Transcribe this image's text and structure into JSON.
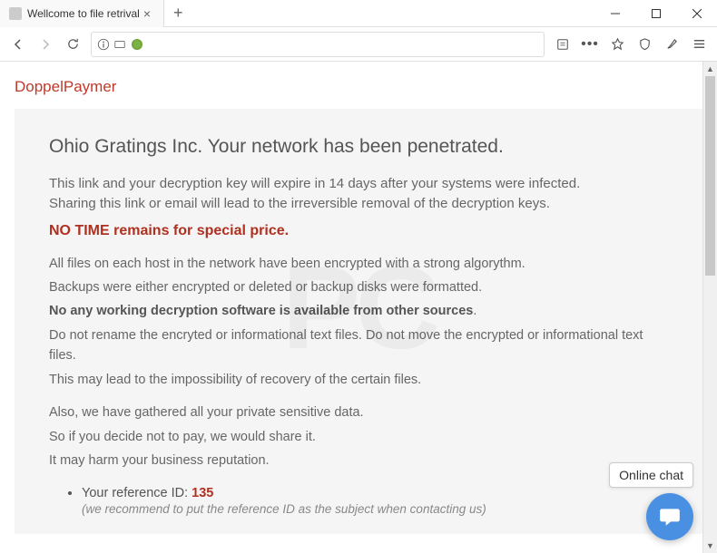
{
  "window": {
    "tab_title": "Wellcome to file retrival"
  },
  "page": {
    "brand": "DoppelPaymer",
    "heading": "Ohio Gratings Inc. Your network has been penetrated.",
    "warn_line1": "This link and your decryption key will expire in 14 days after your systems were infected.",
    "warn_line2": "Sharing this link or email will lead to the irreversible removal of the decryption keys.",
    "notime": "NO TIME remains for special price.",
    "p1": "All files on each host in the network have been encrypted with a strong algorythm.",
    "p2": "Backups were either encrypted or deleted or backup disks were formatted.",
    "p3_strong": "No any working decryption software is available from other sources",
    "p4": "Do not rename the encryted or informational text files. Do not move the encrypted or informational text files.",
    "p5": "This may lead to the impossibility of recovery of the certain files.",
    "p6": "Also, we have gathered all your private sensitive data.",
    "p7": "So if you decide not to pay, we would share it.",
    "p8": "It may harm your business reputation.",
    "ref_label": "Your reference ID: ",
    "ref_id": "135",
    "ref_note": "(we recommend to put the reference ID as the subject when contacting us)"
  },
  "chat": {
    "label": "Online chat"
  }
}
